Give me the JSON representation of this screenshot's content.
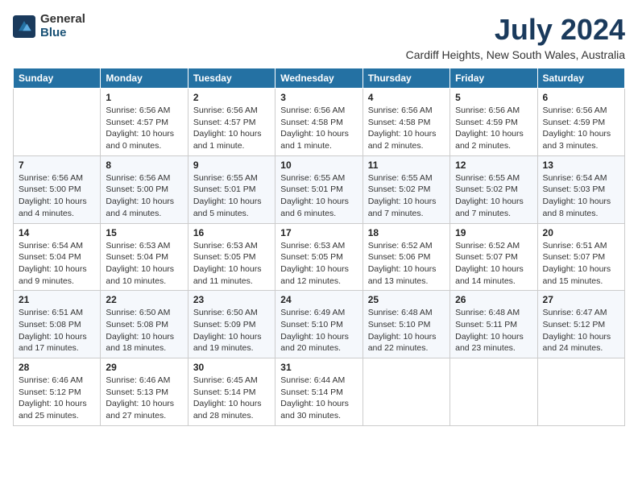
{
  "header": {
    "logo_general": "General",
    "logo_blue": "Blue",
    "month_title": "July 2024",
    "location": "Cardiff Heights, New South Wales, Australia"
  },
  "days_of_week": [
    "Sunday",
    "Monday",
    "Tuesday",
    "Wednesday",
    "Thursday",
    "Friday",
    "Saturday"
  ],
  "weeks": [
    [
      {
        "day": "",
        "sunrise": "",
        "sunset": "",
        "daylight": ""
      },
      {
        "day": "1",
        "sunrise": "Sunrise: 6:56 AM",
        "sunset": "Sunset: 4:57 PM",
        "daylight": "Daylight: 10 hours and 0 minutes."
      },
      {
        "day": "2",
        "sunrise": "Sunrise: 6:56 AM",
        "sunset": "Sunset: 4:57 PM",
        "daylight": "Daylight: 10 hours and 1 minute."
      },
      {
        "day": "3",
        "sunrise": "Sunrise: 6:56 AM",
        "sunset": "Sunset: 4:58 PM",
        "daylight": "Daylight: 10 hours and 1 minute."
      },
      {
        "day": "4",
        "sunrise": "Sunrise: 6:56 AM",
        "sunset": "Sunset: 4:58 PM",
        "daylight": "Daylight: 10 hours and 2 minutes."
      },
      {
        "day": "5",
        "sunrise": "Sunrise: 6:56 AM",
        "sunset": "Sunset: 4:59 PM",
        "daylight": "Daylight: 10 hours and 2 minutes."
      },
      {
        "day": "6",
        "sunrise": "Sunrise: 6:56 AM",
        "sunset": "Sunset: 4:59 PM",
        "daylight": "Daylight: 10 hours and 3 minutes."
      }
    ],
    [
      {
        "day": "7",
        "sunrise": "Sunrise: 6:56 AM",
        "sunset": "Sunset: 5:00 PM",
        "daylight": "Daylight: 10 hours and 4 minutes."
      },
      {
        "day": "8",
        "sunrise": "Sunrise: 6:56 AM",
        "sunset": "Sunset: 5:00 PM",
        "daylight": "Daylight: 10 hours and 4 minutes."
      },
      {
        "day": "9",
        "sunrise": "Sunrise: 6:55 AM",
        "sunset": "Sunset: 5:01 PM",
        "daylight": "Daylight: 10 hours and 5 minutes."
      },
      {
        "day": "10",
        "sunrise": "Sunrise: 6:55 AM",
        "sunset": "Sunset: 5:01 PM",
        "daylight": "Daylight: 10 hours and 6 minutes."
      },
      {
        "day": "11",
        "sunrise": "Sunrise: 6:55 AM",
        "sunset": "Sunset: 5:02 PM",
        "daylight": "Daylight: 10 hours and 7 minutes."
      },
      {
        "day": "12",
        "sunrise": "Sunrise: 6:55 AM",
        "sunset": "Sunset: 5:02 PM",
        "daylight": "Daylight: 10 hours and 7 minutes."
      },
      {
        "day": "13",
        "sunrise": "Sunrise: 6:54 AM",
        "sunset": "Sunset: 5:03 PM",
        "daylight": "Daylight: 10 hours and 8 minutes."
      }
    ],
    [
      {
        "day": "14",
        "sunrise": "Sunrise: 6:54 AM",
        "sunset": "Sunset: 5:04 PM",
        "daylight": "Daylight: 10 hours and 9 minutes."
      },
      {
        "day": "15",
        "sunrise": "Sunrise: 6:53 AM",
        "sunset": "Sunset: 5:04 PM",
        "daylight": "Daylight: 10 hours and 10 minutes."
      },
      {
        "day": "16",
        "sunrise": "Sunrise: 6:53 AM",
        "sunset": "Sunset: 5:05 PM",
        "daylight": "Daylight: 10 hours and 11 minutes."
      },
      {
        "day": "17",
        "sunrise": "Sunrise: 6:53 AM",
        "sunset": "Sunset: 5:05 PM",
        "daylight": "Daylight: 10 hours and 12 minutes."
      },
      {
        "day": "18",
        "sunrise": "Sunrise: 6:52 AM",
        "sunset": "Sunset: 5:06 PM",
        "daylight": "Daylight: 10 hours and 13 minutes."
      },
      {
        "day": "19",
        "sunrise": "Sunrise: 6:52 AM",
        "sunset": "Sunset: 5:07 PM",
        "daylight": "Daylight: 10 hours and 14 minutes."
      },
      {
        "day": "20",
        "sunrise": "Sunrise: 6:51 AM",
        "sunset": "Sunset: 5:07 PM",
        "daylight": "Daylight: 10 hours and 15 minutes."
      }
    ],
    [
      {
        "day": "21",
        "sunrise": "Sunrise: 6:51 AM",
        "sunset": "Sunset: 5:08 PM",
        "daylight": "Daylight: 10 hours and 17 minutes."
      },
      {
        "day": "22",
        "sunrise": "Sunrise: 6:50 AM",
        "sunset": "Sunset: 5:08 PM",
        "daylight": "Daylight: 10 hours and 18 minutes."
      },
      {
        "day": "23",
        "sunrise": "Sunrise: 6:50 AM",
        "sunset": "Sunset: 5:09 PM",
        "daylight": "Daylight: 10 hours and 19 minutes."
      },
      {
        "day": "24",
        "sunrise": "Sunrise: 6:49 AM",
        "sunset": "Sunset: 5:10 PM",
        "daylight": "Daylight: 10 hours and 20 minutes."
      },
      {
        "day": "25",
        "sunrise": "Sunrise: 6:48 AM",
        "sunset": "Sunset: 5:10 PM",
        "daylight": "Daylight: 10 hours and 22 minutes."
      },
      {
        "day": "26",
        "sunrise": "Sunrise: 6:48 AM",
        "sunset": "Sunset: 5:11 PM",
        "daylight": "Daylight: 10 hours and 23 minutes."
      },
      {
        "day": "27",
        "sunrise": "Sunrise: 6:47 AM",
        "sunset": "Sunset: 5:12 PM",
        "daylight": "Daylight: 10 hours and 24 minutes."
      }
    ],
    [
      {
        "day": "28",
        "sunrise": "Sunrise: 6:46 AM",
        "sunset": "Sunset: 5:12 PM",
        "daylight": "Daylight: 10 hours and 25 minutes."
      },
      {
        "day": "29",
        "sunrise": "Sunrise: 6:46 AM",
        "sunset": "Sunset: 5:13 PM",
        "daylight": "Daylight: 10 hours and 27 minutes."
      },
      {
        "day": "30",
        "sunrise": "Sunrise: 6:45 AM",
        "sunset": "Sunset: 5:14 PM",
        "daylight": "Daylight: 10 hours and 28 minutes."
      },
      {
        "day": "31",
        "sunrise": "Sunrise: 6:44 AM",
        "sunset": "Sunset: 5:14 PM",
        "daylight": "Daylight: 10 hours and 30 minutes."
      },
      {
        "day": "",
        "sunrise": "",
        "sunset": "",
        "daylight": ""
      },
      {
        "day": "",
        "sunrise": "",
        "sunset": "",
        "daylight": ""
      },
      {
        "day": "",
        "sunrise": "",
        "sunset": "",
        "daylight": ""
      }
    ]
  ]
}
